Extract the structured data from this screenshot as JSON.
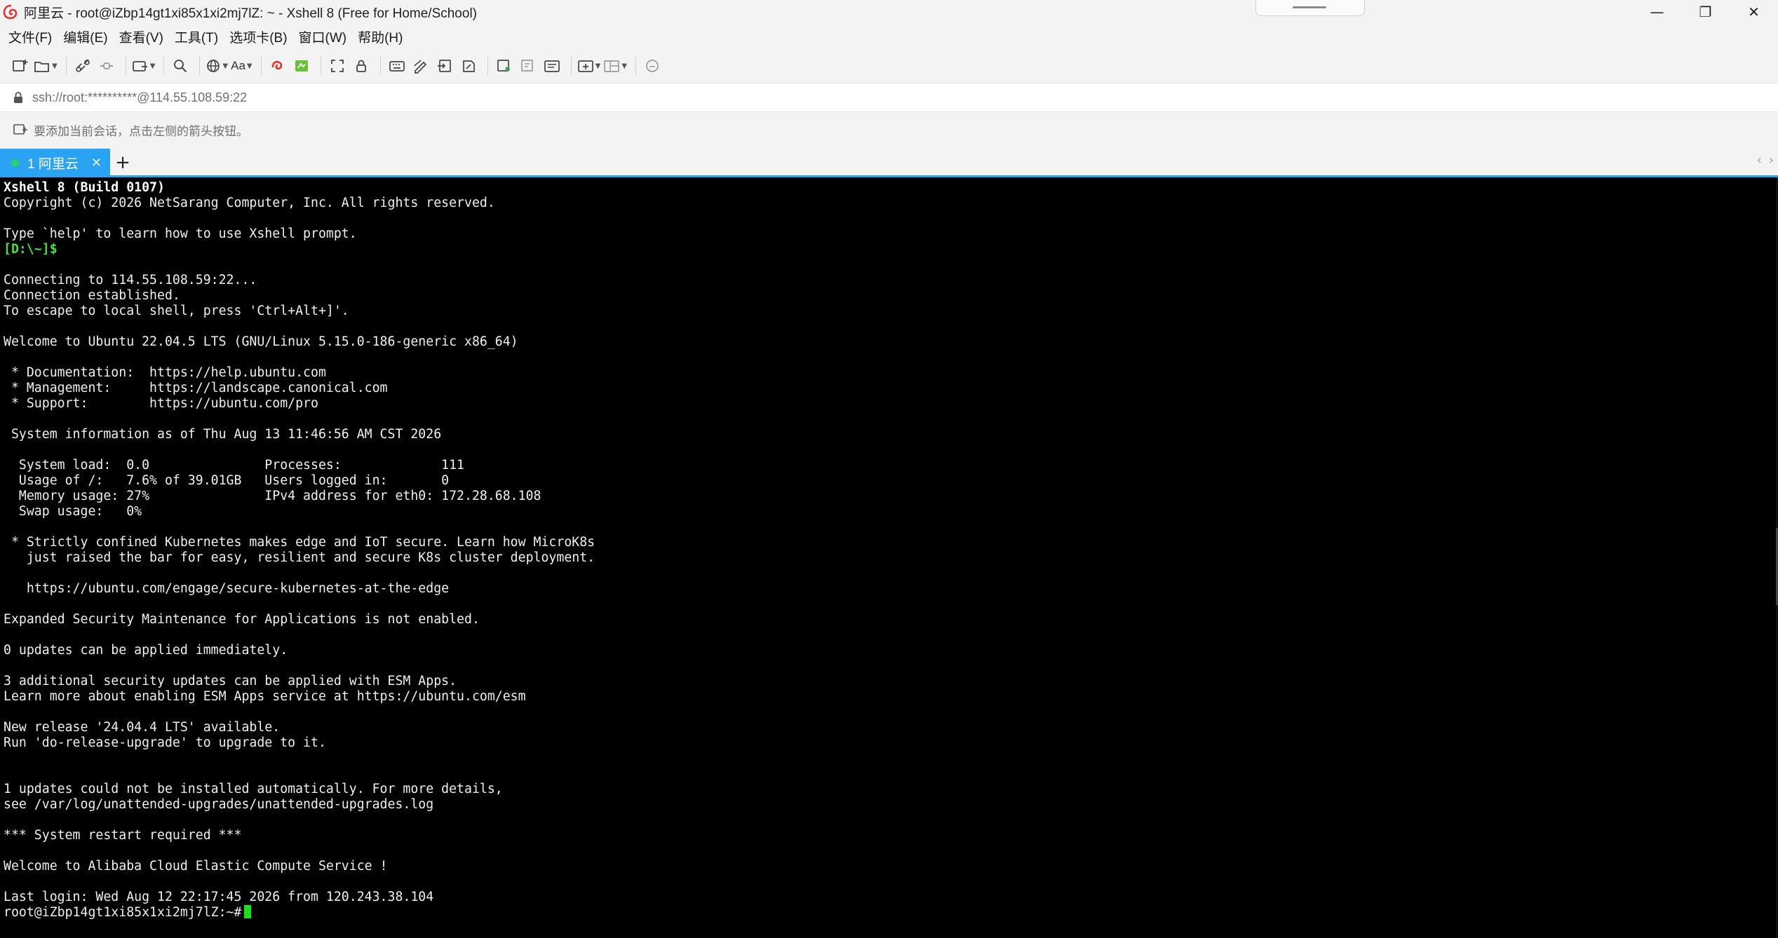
{
  "window": {
    "title": "阿里云 - root@iZbp14gt1xi85x1xi2mj7lZ: ~ - Xshell 8 (Free for Home/School)",
    "controls": {
      "minimize": "—",
      "maximize": "❐",
      "close": "✕"
    }
  },
  "menubar": {
    "items": [
      "文件(F)",
      "编辑(E)",
      "查看(V)",
      "工具(T)",
      "选项卡(B)",
      "窗口(W)",
      "帮助(H)"
    ]
  },
  "toolbar": {
    "font_label": "Aa",
    "icons": [
      "new-session-icon",
      "open-folder-icon",
      "reconnect-icon",
      "disconnect-icon",
      "new-tab-icon",
      "find-icon",
      "globe-icon",
      "font-icon",
      "xftp-icon",
      "xmanager-icon",
      "fullscreen-icon",
      "lock-icon",
      "keyboard-icon",
      "script-icon",
      "transfer-icon",
      "log-icon",
      "run-script-icon",
      "compose-icon",
      "list-icon",
      "add-pane-icon",
      "layout-icon",
      "chat-icon"
    ]
  },
  "address": {
    "value": "ssh://root:**********@114.55.108.59:22"
  },
  "hint": {
    "text": "要添加当前会话，点击左侧的箭头按钮。"
  },
  "tabs": [
    {
      "label": "1 阿里云",
      "active": true,
      "status_color": "#2ad36a"
    }
  ],
  "tab_add_label": "+",
  "tab_nav": {
    "prev": "‹",
    "next": "›"
  },
  "colors": {
    "accent": "#29a3f2",
    "terminal_bg": "#000000",
    "terminal_fg": "#f0f0f0",
    "prompt_green": "#3ee33e"
  },
  "terminal": {
    "lines": [
      "Xshell 8 (Build 0107)",
      "Copyright (c) 2026 NetSarang Computer, Inc. All rights reserved.",
      "",
      "Type `help' to learn how to use Xshell prompt.",
      "[D:\\~]$",
      "",
      "Connecting to 114.55.108.59:22...",
      "Connection established.",
      "To escape to local shell, press 'Ctrl+Alt+]'.",
      "",
      "Welcome to Ubuntu 22.04.5 LTS (GNU/Linux 5.15.0-186-generic x86_64)",
      "",
      " * Documentation:  https://help.ubuntu.com",
      " * Management:     https://landscape.canonical.com",
      " * Support:        https://ubuntu.com/pro",
      "",
      " System information as of Thu Aug 13 11:46:56 AM CST 2026",
      "",
      "  System load:  0.0               Processes:             111",
      "  Usage of /:   7.6% of 39.01GB   Users logged in:       0",
      "  Memory usage: 27%               IPv4 address for eth0: 172.28.68.108",
      "  Swap usage:   0%",
      "",
      " * Strictly confined Kubernetes makes edge and IoT secure. Learn how MicroK8s",
      "   just raised the bar for easy, resilient and secure K8s cluster deployment.",
      "",
      "   https://ubuntu.com/engage/secure-kubernetes-at-the-edge",
      "",
      "Expanded Security Maintenance for Applications is not enabled.",
      "",
      "0 updates can be applied immediately.",
      "",
      "3 additional security updates can be applied with ESM Apps.",
      "Learn more about enabling ESM Apps service at https://ubuntu.com/esm",
      "",
      "New release '24.04.4 LTS' available.",
      "Run 'do-release-upgrade' to upgrade to it.",
      "",
      "",
      "1 updates could not be installed automatically. For more details,",
      "see /var/log/unattended-upgrades/unattended-upgrades.log",
      "",
      "*** System restart required ***",
      "",
      "Welcome to Alibaba Cloud Elastic Compute Service !",
      "",
      "Last login: Wed Aug 12 22:17:45 2026 from 120.243.38.104"
    ],
    "prompt": "root@iZbp14gt1xi85x1xi2mj7lZ:~#"
  }
}
